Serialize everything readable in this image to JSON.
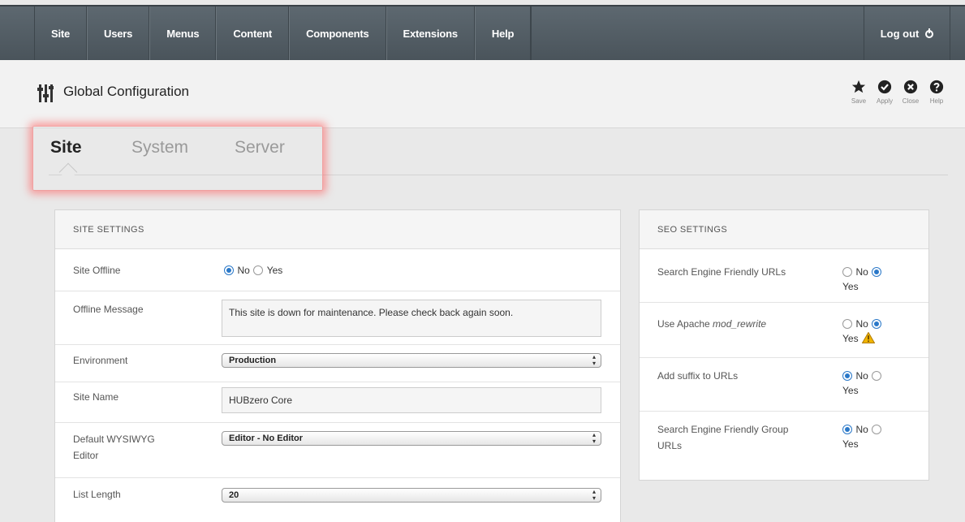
{
  "nav": {
    "items": [
      "Site",
      "Users",
      "Menus",
      "Content",
      "Components",
      "Extensions",
      "Help"
    ],
    "logout_label": "Log out"
  },
  "header": {
    "title": "Global Configuration",
    "toolbar": {
      "save": "Save",
      "apply": "Apply",
      "close": "Close",
      "help": "Help"
    }
  },
  "tabs": {
    "site": "Site",
    "system": "System",
    "server": "Server",
    "active": "Site"
  },
  "site_settings": {
    "heading": "SITE SETTINGS",
    "site_offline": {
      "label": "Site Offline",
      "no": "No",
      "yes": "Yes",
      "value": "No"
    },
    "offline_message": {
      "label": "Offline Message",
      "value": "This site is down for maintenance. Please check back again soon."
    },
    "environment": {
      "label": "Environment",
      "value": "Production"
    },
    "site_name": {
      "label": "Site Name",
      "value": "HUBzero Core"
    },
    "editor": {
      "label_line1": "Default WYSIWYG",
      "label_line2": "Editor",
      "value": "Editor - No Editor"
    },
    "list_length": {
      "label": "List Length",
      "value": "20"
    }
  },
  "seo_settings": {
    "heading": "SEO SETTINGS",
    "sef_urls": {
      "label": "Search Engine Friendly URLs",
      "no": "No",
      "yes": "Yes",
      "value": "Yes"
    },
    "mod_rewrite": {
      "label_prefix": "Use Apache ",
      "label_em": "mod_rewrite",
      "no": "No",
      "yes": "Yes",
      "value": "Yes",
      "warning": true
    },
    "suffix": {
      "label": "Add suffix to URLs",
      "no": "No",
      "yes": "Yes",
      "value": "No"
    },
    "sef_group": {
      "label_line1": "Search Engine Friendly Group",
      "label_line2": "URLs",
      "no": "No",
      "yes": "Yes",
      "value": "No"
    }
  },
  "colors": {
    "nav_bg": "#4f5a61",
    "radio_on": "#2a78c8",
    "tab_highlight": "#ff5a5a",
    "warning": "#f0b400"
  }
}
